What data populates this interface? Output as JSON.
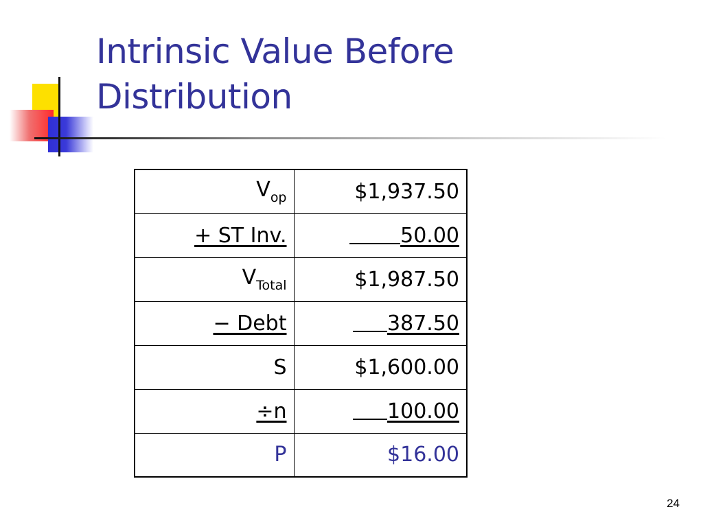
{
  "slide": {
    "title_line1": "Intrinsic Value Before",
    "title_line2": "Distribution",
    "page_number": "24",
    "colors": {
      "title": "#333399",
      "accent": "#333399",
      "text": "#000000"
    }
  },
  "table": {
    "rows": [
      {
        "label_main": "V",
        "label_sub": "op",
        "value": "$1,937.50"
      },
      {
        "label": "+ ST Inv.",
        "value": "50.00"
      },
      {
        "label_main": "V",
        "label_sub": "Total",
        "value": "$1,987.50"
      },
      {
        "label": "− Debt",
        "value": "387.50"
      },
      {
        "label": "S",
        "value": "$1,600.00"
      },
      {
        "label": "÷n",
        "value": "100.00"
      },
      {
        "label": "P",
        "value": "$16.00"
      }
    ]
  }
}
